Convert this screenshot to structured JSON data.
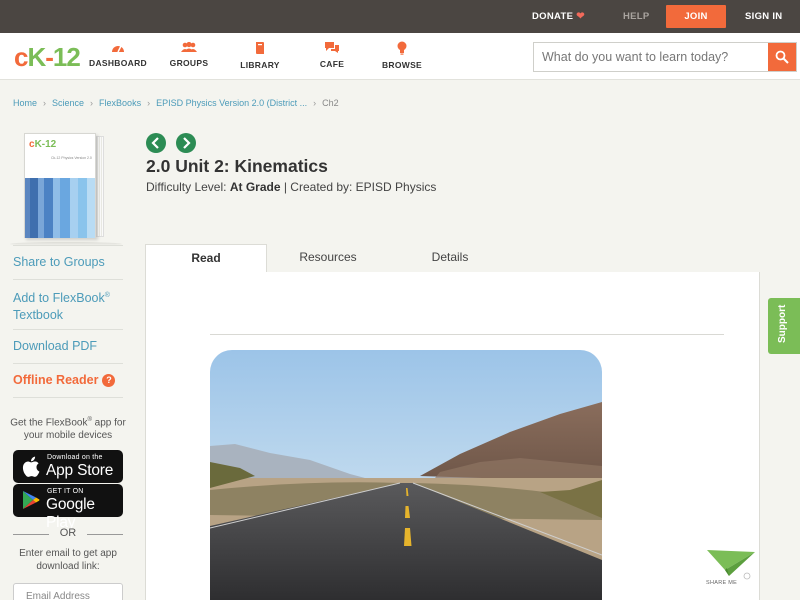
{
  "topbar": {
    "donate": "DONATE",
    "help": "HELP",
    "join": "JOIN",
    "sign_in": "SIGN IN"
  },
  "brand": {
    "logo_c": "c",
    "logo_k": "K",
    "logo_dash": "-",
    "logo_12": "12"
  },
  "nav": {
    "dashboard": "DASHBOARD",
    "groups": "GROUPS",
    "library": "LIBRARY",
    "cafe": "CAFE",
    "browse": "BROWSE"
  },
  "search": {
    "placeholder": "What do you want to learn today?"
  },
  "breadcrumb": {
    "items": [
      "Home",
      "Science",
      "FlexBooks",
      "EPISD Physics Version 2.0 (District ...",
      "Ch2"
    ]
  },
  "book": {
    "logo": "cK-12",
    "subtitle": "Ck-12 Physics Version 2.0"
  },
  "sidebar": {
    "share_to_groups": "Share to Groups",
    "add_to_flexbook": "Add to FlexBook",
    "registered": "®",
    "textbook": "Textbook",
    "download_pdf": "Download PDF",
    "offline_reader": "Offline Reader",
    "help_q": "?",
    "get_app_1": "Get the FlexBook",
    "get_app_2": "app for your mobile devices",
    "app_store_small": "Download on the",
    "app_store_big": "App Store",
    "google_small": "GET IT ON",
    "google_big": "Google Play",
    "or": "OR",
    "email_text": "Enter email to get app download link:",
    "email_placeholder": "Email Address"
  },
  "content": {
    "title": "2.0 Unit 2: Kinematics",
    "difficulty_label": "Difficulty Level:",
    "difficulty_value": "At Grade",
    "created_by": "| Created by: EPISD Physics"
  },
  "tabs": {
    "read": "Read",
    "resources": "Resources",
    "details": "Details"
  },
  "support": "Support",
  "share_me": "SHARE ME",
  "colors": {
    "accent_orange": "#f26a3b",
    "accent_green": "#7bbd57",
    "link_blue": "#4c9bb9",
    "topbar": "#4b4642",
    "nav_green": "#2c8c54"
  }
}
